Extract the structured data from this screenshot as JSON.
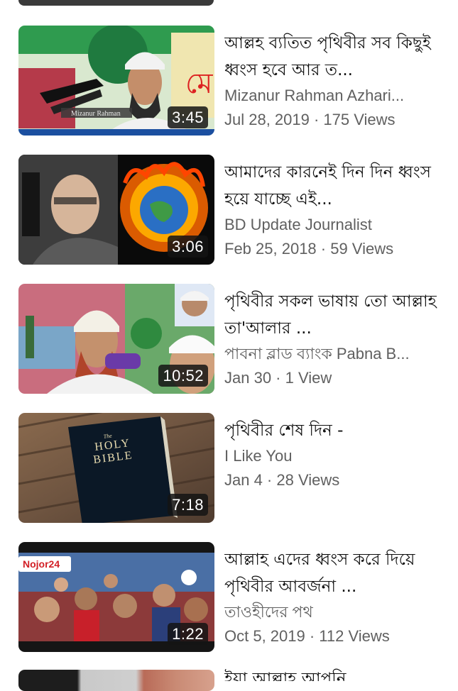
{
  "videos": [
    {
      "title": "আল্লহ ব্যতিত পৃথিবীর সব কিছুই ধ্বংস হবে আর ত...",
      "channel": "Mizanur Rahman Azhari...",
      "meta": "Jul 28, 2019 · 175 Views",
      "duration": "3:45",
      "thumb_caption": "Mizanur Rahman"
    },
    {
      "title": "আমাদের কারনেই দিন দিন ধ্বংস হয়ে যাচ্ছে এই...",
      "channel": "BD Update Journalist",
      "meta": "Feb 25, 2018 · 59 Views",
      "duration": "3:06"
    },
    {
      "title": "পৃথিবীর সকল ভাষায় তো আল্লাহ তা'আলার ...",
      "channel": "পাবনা ব্লাড ব্যাংক Pabna B...",
      "meta": "Jan 30 · 1 View",
      "duration": "10:52"
    },
    {
      "title": "পৃথিবীর শেষ দিন -",
      "channel": "I Like You",
      "meta": "Jan 4 · 28 Views",
      "duration": "7:18",
      "book_the": "The",
      "book_holy": "HOLY",
      "book_bible": "BIBLE"
    },
    {
      "title": "আল্লাহ এদের ধ্বংস করে দিয়ে পৃথিবীর আবর্জনা ...",
      "channel": "তাওহীদের পথ",
      "meta": "Oct 5, 2019 · 112 Views",
      "duration": "1:22",
      "logo": "Nojor24"
    }
  ],
  "partial_title": "ইয়া আল্লাহ আপনি"
}
